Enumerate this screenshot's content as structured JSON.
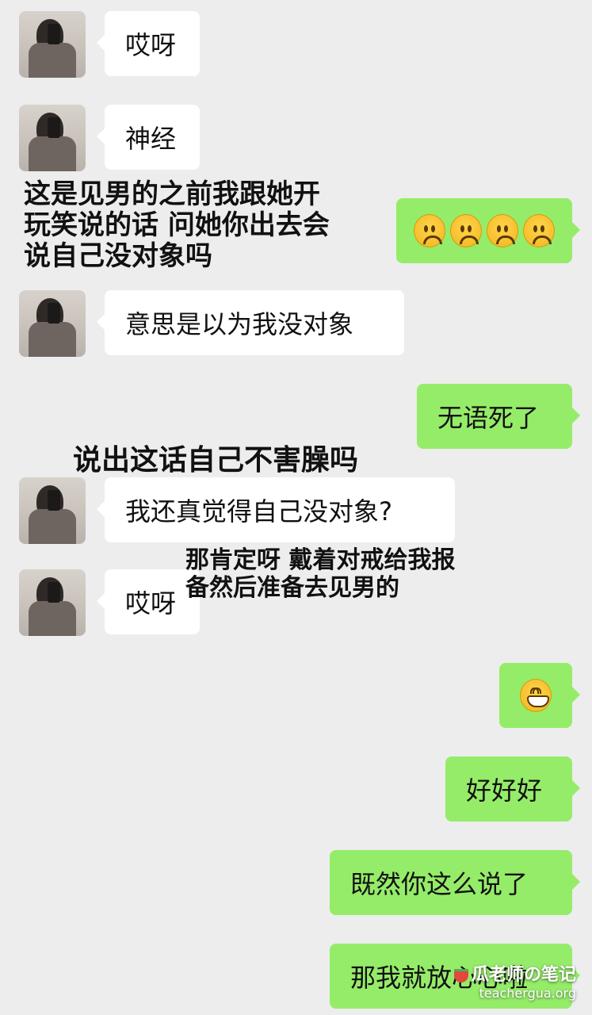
{
  "messages": [
    {
      "side": "left",
      "text": "哎呀"
    },
    {
      "side": "left",
      "text": "神经"
    },
    {
      "side": "right",
      "text": "☹☹☹☹"
    },
    {
      "side": "left",
      "text": "意思是以为我没对象"
    },
    {
      "side": "right",
      "text": "无语死了"
    },
    {
      "side": "left",
      "text": "我还真觉得自己没对象?"
    },
    {
      "side": "left",
      "text": "哎呀"
    },
    {
      "side": "right",
      "text": "😁"
    },
    {
      "side": "right",
      "text": "好好好"
    },
    {
      "side": "right",
      "text": "既然你这么说了"
    },
    {
      "side": "right",
      "text": "那我就放心心啦"
    }
  ],
  "annotations": [
    {
      "lines": [
        "这是见男的之前我跟她开",
        "玩笑说的话 问她你出去会",
        "说自己没对象吗"
      ]
    },
    {
      "lines": [
        "说出这话自己不害臊吗"
      ]
    },
    {
      "lines": [
        "那肯定呀 戴着对戒给我报",
        "备然后准备去见男的"
      ]
    }
  ],
  "watermark": {
    "title": "瓜老师の笔记",
    "site": "teachergua.org"
  },
  "colors": {
    "background": "#ededed",
    "left_bubble": "#ffffff",
    "right_bubble": "#95ec69"
  }
}
